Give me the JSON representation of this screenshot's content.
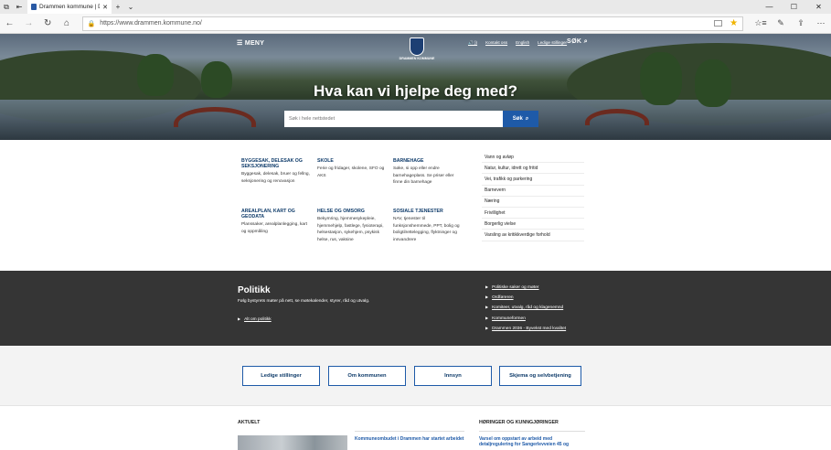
{
  "browser": {
    "tab_title": "Drammen kommune | D",
    "url": "https://www.drammen.kommune.no/"
  },
  "header": {
    "menu_label": "☰ MENY",
    "logo_text": "DRAMMEN KOMMUNE",
    "toplinks": [
      "🔊 ))",
      "Kontakt oss",
      "English",
      "Ledige stillinger"
    ],
    "search_label": "SØK ⌕"
  },
  "hero": {
    "headline": "Hva kan vi hjelpe deg med?",
    "search_placeholder": "Søk i hele nettstedet",
    "search_button": "Søk"
  },
  "services": [
    {
      "title": "BYGGESAK, DELESAK OG SEKSJONERING",
      "desc": "Byggesak, delesak, bruer og fellng, seksjonering og renovasjon"
    },
    {
      "title": "SKOLE",
      "desc": "Ferie og fridager, skolene, SFO og AKS"
    },
    {
      "title": "BARNEHAGE",
      "desc": "Søke, si opp eller endre barnehageplass. Se priser eller finne din barnehage"
    },
    {
      "title": "AREALPLAN, KART OG GEODATA",
      "desc": "Planssaker, arealplanlegging, kart og oppmåling"
    },
    {
      "title": "HELSE OG OMSORG",
      "desc": "Bekymring, hjemmesykepleie, hjemmehjelp, fastlege, fysioterapi, helsestasjon, sykehjem, psykisk helse, rus, vaksine"
    },
    {
      "title": "SOSIALE TJENESTER",
      "desc": "NAV, tjenester til funksjonshemmede, PPT, bolig og boligtilrettelegging, flyktninger og innvandrere"
    }
  ],
  "quicklist": [
    "Vann og avløp",
    "Natur, kultur, idrett og fritid",
    "Vei, trafikk og parkering",
    "Barnevern",
    "Næring",
    "Frivillighet",
    "Borgerlig vielse",
    "Varsling av kritikkverdige forhold"
  ],
  "politikk": {
    "title": "Politikk",
    "desc": "Følg bystyrets møter på nett, se møtekalender, styrer, råd og utvalg.",
    "all_link": "Alt om politikk",
    "links": [
      "Politiske saker og møter",
      "Ordføreren",
      "Komiteer, utvalg, råd og klagenemnd",
      "Kommuneformen",
      "Drammen 2036 - Byvekst med kvalitet"
    ]
  },
  "quick_buttons": [
    "Ledige stillinger",
    "Om kommunen",
    "Innsyn",
    "Skjema og selvbetjening"
  ],
  "news": {
    "heading": "AKTUELT",
    "item_title": "Kommuneombudet i Drammen har startet arbeidet",
    "hearings_heading": "HØRINGER OG KUNNGJØRINGER",
    "hearing_title": "Varsel om oppstart av arbeid med detaljregulering for Sangerlevveien 45 og"
  },
  "colors": {
    "accent": "#1e5aa8",
    "dark_band": "#353535",
    "heading": "#0d3a69"
  }
}
